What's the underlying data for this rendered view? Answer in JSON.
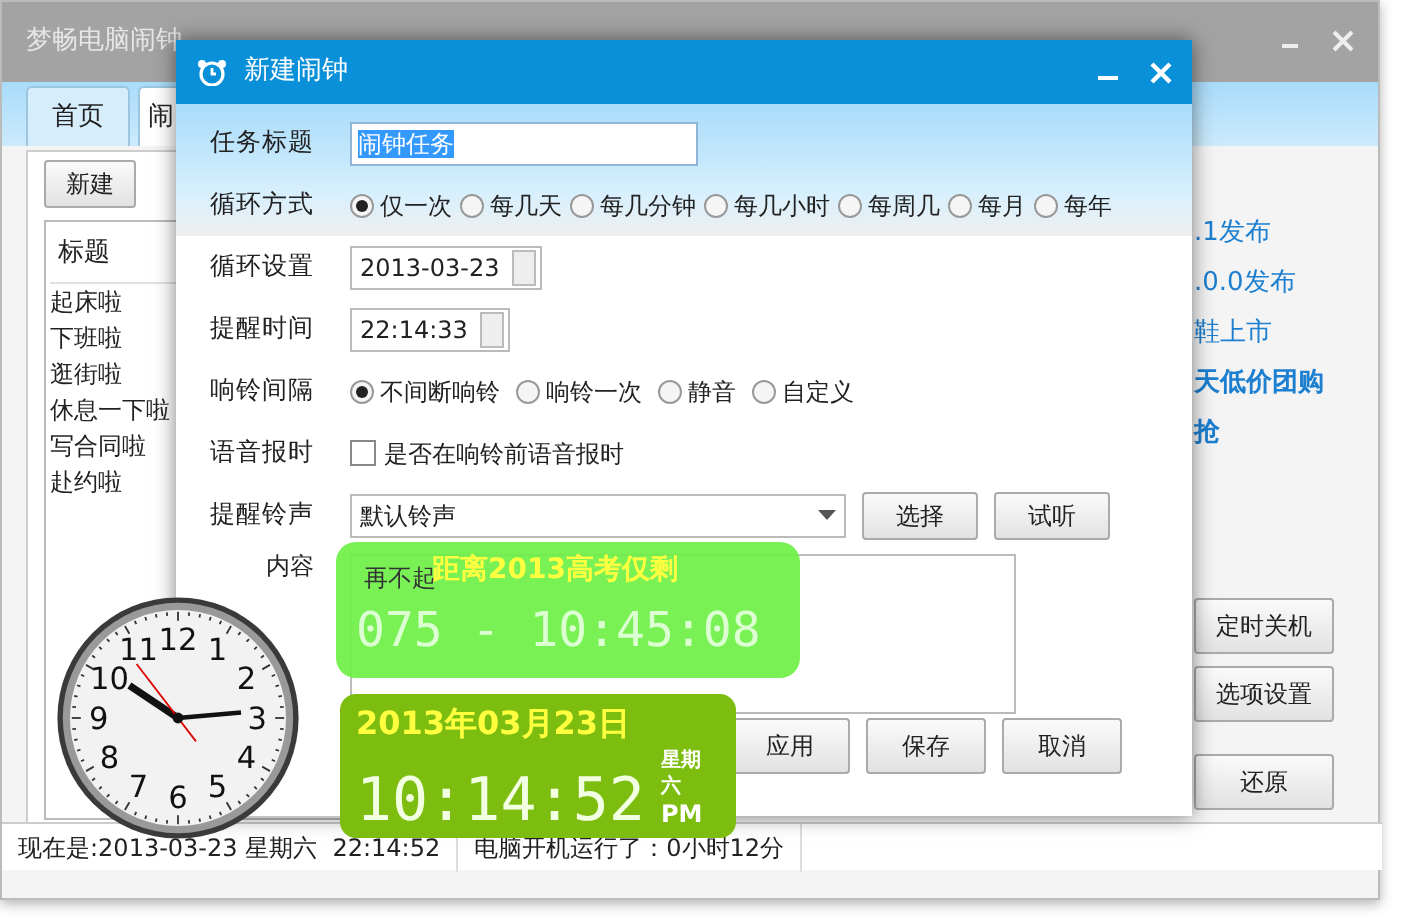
{
  "main_window": {
    "title": "梦畅电脑闹钟",
    "tabs": [
      {
        "label": "首页",
        "selected": false
      },
      {
        "label": "闹",
        "selected": true
      }
    ],
    "new_button": "新建",
    "list": {
      "header": "标题",
      "items": [
        "起床啦",
        "下班啦",
        "逛街啦",
        "休息一下啦",
        "写合同啦",
        "赴约啦"
      ]
    },
    "links": [
      {
        "label": ".1发布",
        "bold": false
      },
      {
        "label": ".0.0发布",
        "bold": false
      },
      {
        "label": "鞋上市",
        "bold": false
      },
      {
        "label": "天低价团购",
        "bold": true
      },
      {
        "label": "抢",
        "bold": true
      }
    ],
    "buttons": [
      "定时关机",
      "选项设置",
      "还原"
    ],
    "status_bar": [
      "现在是:2013-03-23 星期六  22:14:52",
      "电脑开机运行了：0小时12分"
    ]
  },
  "dialog": {
    "title": "新建闹钟",
    "fields": [
      {
        "kind": "text",
        "label": "任务标题",
        "value": "闹钟任务",
        "highlighted": true
      },
      {
        "kind": "radio",
        "label": "循环方式",
        "options": [
          {
            "label": "仅一次",
            "selected": true
          },
          {
            "label": "每几天",
            "selected": false
          },
          {
            "label": "每几分钟",
            "selected": false
          },
          {
            "label": "每几小时",
            "selected": false
          },
          {
            "label": "每周几",
            "selected": false
          },
          {
            "label": "每月",
            "selected": false
          },
          {
            "label": "每年",
            "selected": false
          }
        ]
      },
      {
        "kind": "spin",
        "label": "循环设置",
        "value": "2013-03-23"
      },
      {
        "kind": "spin",
        "label": "提醒时间",
        "value": "22:14:33"
      },
      {
        "kind": "radio",
        "label": "响铃间隔",
        "options": [
          {
            "label": "不间断响铃",
            "selected": true
          },
          {
            "label": "响铃一次",
            "selected": false
          },
          {
            "label": "静音",
            "selected": false
          },
          {
            "label": "自定义",
            "selected": false
          }
        ]
      },
      {
        "kind": "checkbox",
        "label": "语音报时",
        "text": "是否在响铃前语音报时",
        "checked": false
      },
      {
        "kind": "select",
        "label": "提醒铃声",
        "value": "默认铃声",
        "buttons": [
          "选择",
          "试听"
        ]
      },
      {
        "kind": "textarea",
        "label": "内容",
        "value": "再不起"
      }
    ],
    "buttons": [
      "应用",
      "保存",
      "取消"
    ]
  },
  "countdown": {
    "title": "距离2013高考仅剩",
    "value": "075 - 10:45:08"
  },
  "digital_clock": {
    "date": "2013年03月23日",
    "time": "10:14:52",
    "weekday": "星期六",
    "period": "PM"
  },
  "analog_clock": {
    "numbers": [
      "12",
      "11",
      "1",
      "10",
      "2",
      "9",
      "3",
      "8",
      "4",
      "7",
      "5",
      "6"
    ]
  }
}
